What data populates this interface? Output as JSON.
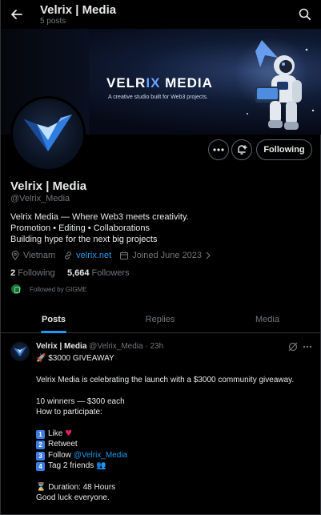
{
  "header": {
    "title": "Velrix | Media",
    "post_count": "5 posts"
  },
  "banner": {
    "brand_main": "VELR",
    "brand_accent": "IX",
    "brand_tail": " MEDIA",
    "tagline": "A creative studio built for Web3 projects."
  },
  "actions": {
    "following_label": "Following"
  },
  "profile": {
    "name": "Velrix | Media",
    "handle": "@Velrix_Media",
    "bio": [
      "Velrix Media — Where Web3 meets creativity.",
      "Promotion • Editing • Collaborations",
      "Building hype for the next big projects"
    ],
    "location": "Vietnam",
    "website": "velrix.net",
    "joined": "Joined June 2023",
    "following_count": "2",
    "following_label": "Following",
    "followers_count": "5,664",
    "followers_label": "Followers",
    "followed_by": "Followed by GIGME"
  },
  "tabs": [
    {
      "label": "Posts",
      "active": true
    },
    {
      "label": "Replies",
      "active": false
    },
    {
      "label": "Media",
      "active": false
    }
  ],
  "post": {
    "name": "Velrix | Media",
    "handle": "@Velrix_Media",
    "time": "23h",
    "line_title": "$3000 GIVEAWAY",
    "line_announce": "Velrix Media is celebrating the launch with a $3000 community giveaway.",
    "line_winners": "10 winners — $300 each",
    "line_how": "How to participate:",
    "step1": "Like",
    "step2": "Retweet",
    "step3": "Follow",
    "step3_mention": "@Velrix_Media",
    "step4": "Tag 2 friends",
    "duration": "Duration: 48 Hours",
    "closing": "Good luck everyone."
  },
  "icons": {
    "rocket": "🚀",
    "heart": "♥",
    "hourglass": "⌛",
    "people": "👥",
    "keycaps": [
      "1",
      "2",
      "3",
      "4"
    ]
  },
  "colors": {
    "accent": "#1d9bf0",
    "background": "#000000",
    "muted": "#71767b",
    "keycap": "#3b7de0",
    "heart": "#e0245e"
  }
}
